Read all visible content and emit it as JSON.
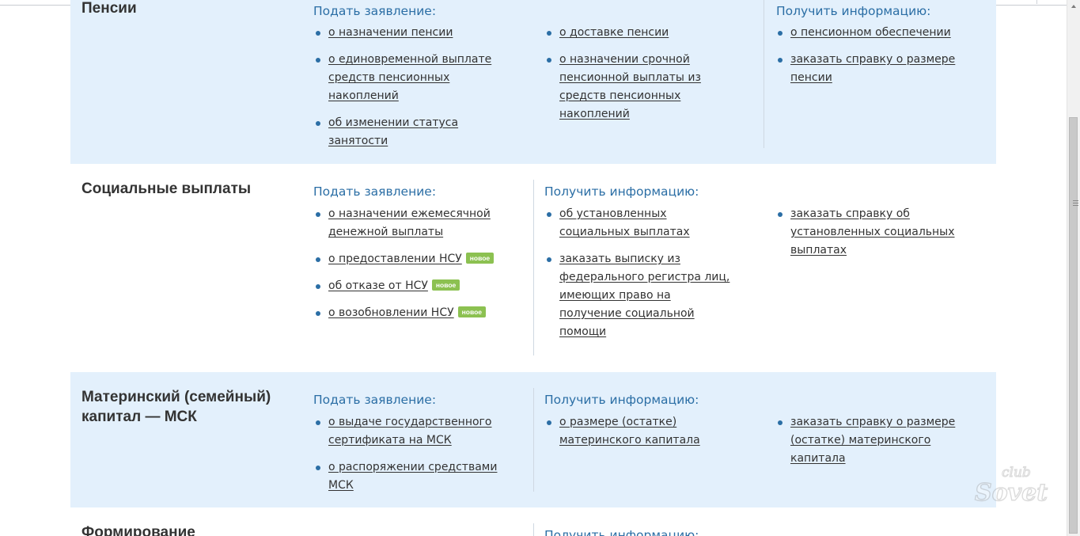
{
  "sections": {
    "pensions": {
      "title": "Пенсии",
      "apply_heading": "Подать заявление:",
      "info_heading": "Получить информацию:",
      "apply_col1": [
        "о назначении пенсии",
        "о единовременной выплате средств пенсионных накоплений",
        "об изменении статуса занятости"
      ],
      "apply_col2": [
        "о доставке пенсии",
        "о назначении срочной пенсионной выплаты из средств пенсионных накоплений"
      ],
      "info_col": [
        "о пенсионном обеспечении",
        "заказать справку о размере пенсии"
      ]
    },
    "social": {
      "title": "Социальные выплаты",
      "apply_heading": "Подать заявление:",
      "info_heading": "Получить информацию:",
      "apply_col": [
        "о назначении ежемесячной денежной выплаты",
        "о предоставлении НСУ",
        "об отказе от НСУ",
        "о возобновлении НСУ"
      ],
      "badge": "новое",
      "info_col1": [
        "об установленных социальных выплатах",
        "заказать выписку из федерального регистра лиц, имеющих право на получение социальной помощи"
      ],
      "info_col2": [
        "заказать справку об установленных социальных выплатах"
      ]
    },
    "maternity": {
      "title": "Материнский (семейный) капитал — МСК",
      "apply_heading": "Подать заявление:",
      "info_heading": "Получить информацию:",
      "apply_col": [
        "о выдаче государственного сертификата на МСК",
        "о распоряжении средствами МСК"
      ],
      "info_col1": [
        "о размере (остатке) материнского капитала"
      ],
      "info_col2": [
        "заказать справку о размере (остатке) материнского капитала"
      ]
    },
    "forming": {
      "title": "Формирование",
      "info_heading": "Получить информацию:"
    }
  },
  "watermark": "club Sovet",
  "colors": {
    "section_bg": "#e3f0fc",
    "heading": "#2b6ea5",
    "badge": "#8cc151"
  }
}
